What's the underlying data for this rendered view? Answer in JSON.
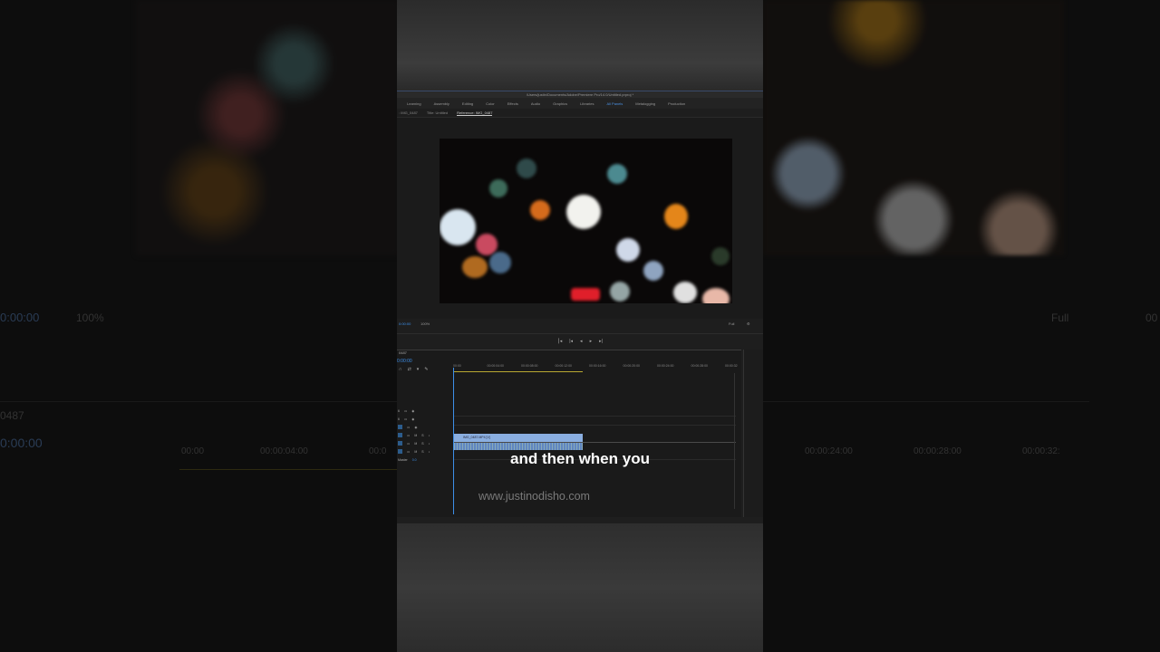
{
  "backdrop": {
    "left_timecode": "0:00:00",
    "left_zoom": "100%",
    "left_clip_label": "0487",
    "left_timecode2": "0:00:00",
    "left_ruler": [
      "00:00",
      "00:00:04:00",
      "00:0"
    ],
    "right_zoom": "Full",
    "right_timecode": "00",
    "right_ruler": [
      "00:00:24:00",
      "00:00:28:00",
      "00:00:32:"
    ]
  },
  "app": {
    "title": "/Users/justin/Documents/Adobe/Premiere Pro/14.0/Untitled.prproj *",
    "workspaces": [
      {
        "label": "Learning",
        "active": false
      },
      {
        "label": "Assembly",
        "active": false
      },
      {
        "label": "Editing",
        "active": false
      },
      {
        "label": "Color",
        "active": false
      },
      {
        "label": "Effects",
        "active": false
      },
      {
        "label": "Audio",
        "active": false
      },
      {
        "label": "Graphics",
        "active": false
      },
      {
        "label": "Libraries",
        "active": false
      },
      {
        "label": "All Panels",
        "active": true
      },
      {
        "label": "Metalogging",
        "active": false
      },
      {
        "label": "Production",
        "active": false
      }
    ],
    "subtabs": [
      {
        "label": ": IMG_0487",
        "active": false
      },
      {
        "label": "Title: Untitled",
        "active": false
      },
      {
        "label": "Reference: IMG_0487",
        "active": true
      }
    ],
    "monitor": {
      "timecode": "0:00:00",
      "zoom": "100%",
      "quality": "Full"
    },
    "timeline": {
      "sequence": "0487",
      "timecode": "0:00:00",
      "ruler": [
        "00:00",
        "00:00:04:00",
        "00:00:08:00",
        "00:00:12:00",
        "00:00:16:00",
        "00:00:20:00",
        "00:00:24:00",
        "00:00:28:00",
        "00:00:32"
      ],
      "clip_label": "IMG_0487.MP4 [V]",
      "mix_label": "Master"
    }
  },
  "caption": "and then when you",
  "watermark": "www.justinodisho.com"
}
